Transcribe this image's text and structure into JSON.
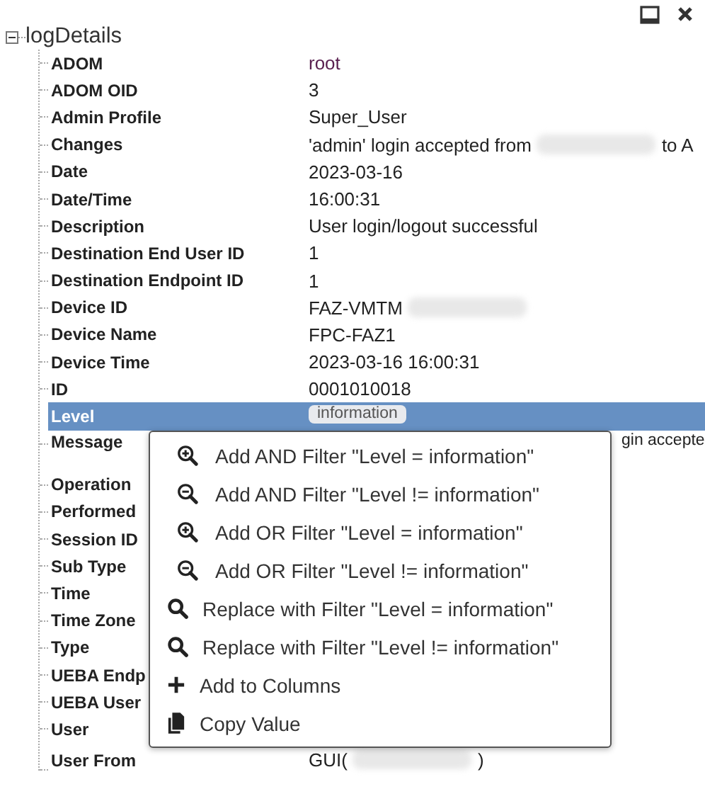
{
  "tree": {
    "title": "logDetails",
    "expanded": true,
    "rows": [
      {
        "label": "ADOM",
        "selected": false,
        "value": [
          {
            "kind": "text",
            "text": "root"
          }
        ]
      },
      {
        "label": "ADOM OID",
        "selected": false,
        "value": [
          {
            "kind": "text",
            "text": "3"
          }
        ]
      },
      {
        "label": "Admin Profile",
        "selected": false,
        "value": [
          {
            "kind": "text",
            "text": "Super_User"
          }
        ]
      },
      {
        "label": "Changes",
        "selected": false,
        "value": [
          {
            "kind": "text",
            "text": "'admin' login accepted from"
          },
          {
            "kind": "redacted"
          },
          {
            "kind": "text",
            "text": "to A"
          }
        ]
      },
      {
        "label": "Date",
        "selected": false,
        "value": [
          {
            "kind": "text",
            "text": "2023-03-16"
          }
        ]
      },
      {
        "label": "Date/Time",
        "selected": false,
        "value": [
          {
            "kind": "text",
            "text": "16:00:31"
          }
        ]
      },
      {
        "label": "Description",
        "selected": false,
        "value": [
          {
            "kind": "text",
            "text": "User login/logout successful"
          }
        ]
      },
      {
        "label": "Destination End User ID",
        "selected": false,
        "value": [
          {
            "kind": "text",
            "text": "1"
          }
        ]
      },
      {
        "label": "Destination Endpoint ID",
        "selected": false,
        "value": [
          {
            "kind": "text",
            "text": "1"
          }
        ]
      },
      {
        "label": "Device ID",
        "selected": false,
        "value": [
          {
            "kind": "text",
            "text": "FAZ-VMTM"
          },
          {
            "kind": "redacted"
          }
        ]
      },
      {
        "label": "Device Name",
        "selected": false,
        "value": [
          {
            "kind": "text",
            "text": "FPC-FAZ1"
          }
        ]
      },
      {
        "label": "Device Time",
        "selected": false,
        "value": [
          {
            "kind": "text",
            "text": "2023-03-16 16:00:31"
          }
        ]
      },
      {
        "label": "ID",
        "selected": false,
        "value": [
          {
            "kind": "text",
            "text": "0001010018"
          }
        ]
      },
      {
        "label": "Level",
        "selected": true,
        "value": [
          {
            "kind": "badge",
            "text": "information"
          }
        ]
      },
      {
        "label": "Message",
        "selected": false,
        "tall": true,
        "value": [
          {
            "kind": "covered",
            "text": "gin accepte"
          }
        ]
      },
      {
        "label": "Operation",
        "selected": false,
        "value": []
      },
      {
        "label": "Performed",
        "selected": false,
        "value": []
      },
      {
        "label": "Session ID",
        "selected": false,
        "value": []
      },
      {
        "label": "Sub Type",
        "selected": false,
        "value": []
      },
      {
        "label": "Time",
        "selected": false,
        "value": []
      },
      {
        "label": "Time Zone",
        "selected": false,
        "value": []
      },
      {
        "label": "Type",
        "selected": false,
        "value": []
      },
      {
        "label": "UEBA Endp",
        "selected": false,
        "value": []
      },
      {
        "label": "UEBA User",
        "selected": false,
        "value": []
      },
      {
        "label": "User",
        "selected": false,
        "value": []
      },
      {
        "label": "User From",
        "selected": false,
        "value": [
          {
            "kind": "text",
            "text": "GUI("
          },
          {
            "kind": "redacted"
          },
          {
            "kind": "text",
            "text": ")"
          }
        ]
      }
    ]
  },
  "context_menu": [
    {
      "kind": "include",
      "label": "Add AND Filter \"Level = information\""
    },
    {
      "kind": "exclude",
      "label": "Add AND Filter \"Level != information\""
    },
    {
      "kind": "include",
      "label": "Add OR Filter \"Level = information\""
    },
    {
      "kind": "exclude",
      "label": "Add OR Filter \"Level != information\""
    },
    {
      "kind": "replace",
      "label": "Replace with Filter \"Level = information\""
    },
    {
      "kind": "replace",
      "label": "Replace with Filter \"Level != information\""
    },
    {
      "kind": "column",
      "label": "Add to Columns"
    },
    {
      "kind": "copy",
      "label": "Copy Value"
    }
  ]
}
